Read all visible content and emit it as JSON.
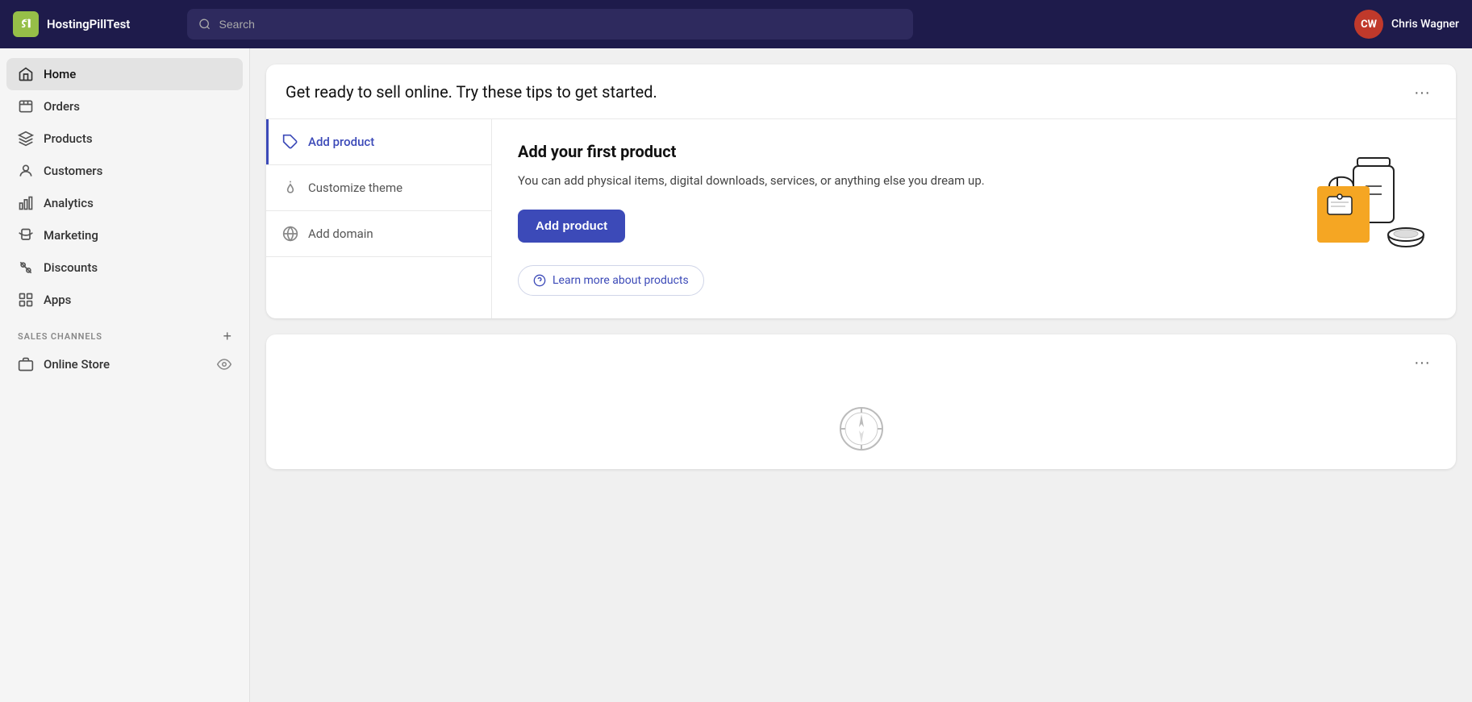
{
  "brand": {
    "name": "HostingPillTest",
    "icon_letter": "S"
  },
  "search": {
    "placeholder": "Search"
  },
  "user": {
    "name": "Chris Wagner",
    "initials": "CW"
  },
  "sidebar": {
    "items": [
      {
        "id": "home",
        "label": "Home",
        "active": true
      },
      {
        "id": "orders",
        "label": "Orders",
        "active": false
      },
      {
        "id": "products",
        "label": "Products",
        "active": false
      },
      {
        "id": "customers",
        "label": "Customers",
        "active": false
      },
      {
        "id": "analytics",
        "label": "Analytics",
        "active": false
      },
      {
        "id": "marketing",
        "label": "Marketing",
        "active": false
      },
      {
        "id": "discounts",
        "label": "Discounts",
        "active": false
      },
      {
        "id": "apps",
        "label": "Apps",
        "active": false
      }
    ],
    "sales_channels_label": "SALES CHANNELS",
    "online_store_label": "Online Store"
  },
  "card1": {
    "title": "Get ready to sell online. Try these tips to get started.",
    "more_label": "···",
    "tips": [
      {
        "id": "add-product",
        "label": "Add product",
        "active": true
      },
      {
        "id": "customize-theme",
        "label": "Customize theme",
        "active": false
      },
      {
        "id": "add-domain",
        "label": "Add domain",
        "active": false
      }
    ],
    "detail": {
      "title": "Add your first product",
      "description": "You can add physical items, digital downloads, services, or anything else you dream up.",
      "action_label": "Add product",
      "learn_more_label": "Learn more about products"
    }
  },
  "card2": {
    "more_label": "···"
  }
}
